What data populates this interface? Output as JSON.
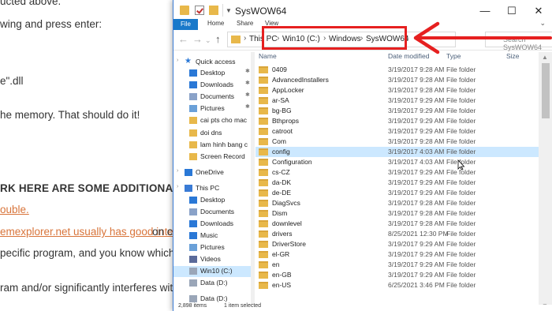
{
  "article": {
    "lines": [
      "ucted above.",
      "wing and press enter:",
      "e\".dll",
      "he memory. That should do it!",
      "RK HERE ARE SOME ADDITIONAL RESOURC",
      "ouble.",
      "emexplorer.net usually has good intel",
      "on c",
      "pecific program, and you know which one,",
      "ram and/or significantly interferes with usa"
    ]
  },
  "window": {
    "title": "SysWOW64",
    "controls": {
      "minimize": "—",
      "maximize": "☐",
      "close": "✕"
    }
  },
  "ribbon": {
    "tabs": [
      "File",
      "Home",
      "Share",
      "View"
    ]
  },
  "address": {
    "crumbs": [
      "This PC",
      "Win10 (C:)",
      "Windows",
      "SysWOW64"
    ]
  },
  "search": {
    "placeholder": "Search SysWOW64"
  },
  "nav": {
    "items": [
      {
        "label": "Quick access",
        "icon": "star-icon",
        "pinned": false
      },
      {
        "label": "Desktop",
        "icon": "desktop-icon",
        "pinned": true
      },
      {
        "label": "Downloads",
        "icon": "download-icon",
        "pinned": true
      },
      {
        "label": "Documents",
        "icon": "document-icon",
        "pinned": true
      },
      {
        "label": "Pictures",
        "icon": "picture-icon",
        "pinned": true
      },
      {
        "label": "cai pts cho mac",
        "icon": "folder-icon",
        "pinned": false
      },
      {
        "label": "doi dns",
        "icon": "folder-icon",
        "pinned": false
      },
      {
        "label": "lam hinh bang c",
        "icon": "folder-icon",
        "pinned": false
      },
      {
        "label": "Screen Record",
        "icon": "folder-icon",
        "pinned": false
      },
      {
        "label": "OneDrive",
        "icon": "cloud-icon",
        "pinned": false
      },
      {
        "label": "This PC",
        "icon": "computer-icon",
        "pinned": false
      },
      {
        "label": "Desktop",
        "icon": "desktop-icon",
        "pinned": false
      },
      {
        "label": "Documents",
        "icon": "document-icon",
        "pinned": false
      },
      {
        "label": "Downloads",
        "icon": "download-icon",
        "pinned": false
      },
      {
        "label": "Music",
        "icon": "music-icon",
        "pinned": false
      },
      {
        "label": "Pictures",
        "icon": "picture-icon",
        "pinned": false
      },
      {
        "label": "Videos",
        "icon": "video-icon",
        "pinned": false
      },
      {
        "label": "Win10 (C:)",
        "icon": "drive-icon",
        "pinned": false,
        "selected": true
      },
      {
        "label": "Data (D:)",
        "icon": "drive-icon",
        "pinned": false
      },
      {
        "label": "Data (D:)",
        "icon": "drive-icon",
        "pinned": false
      }
    ]
  },
  "columns": {
    "name": "Name",
    "date": "Date modified",
    "type": "Type",
    "size": "Size"
  },
  "files": [
    {
      "name": "0409",
      "date": "3/19/2017 9:28 AM",
      "type": "File folder"
    },
    {
      "name": "AdvancedInstallers",
      "date": "3/19/2017 9:28 AM",
      "type": "File folder"
    },
    {
      "name": "AppLocker",
      "date": "3/19/2017 9:28 AM",
      "type": "File folder"
    },
    {
      "name": "ar-SA",
      "date": "3/19/2017 9:29 AM",
      "type": "File folder"
    },
    {
      "name": "bg-BG",
      "date": "3/19/2017 9:29 AM",
      "type": "File folder"
    },
    {
      "name": "Bthprops",
      "date": "3/19/2017 9:29 AM",
      "type": "File folder"
    },
    {
      "name": "catroot",
      "date": "3/19/2017 9:29 AM",
      "type": "File folder"
    },
    {
      "name": "Com",
      "date": "3/19/2017 9:28 AM",
      "type": "File folder"
    },
    {
      "name": "config",
      "date": "3/19/2017 4:03 AM",
      "type": "File folder",
      "hover": true
    },
    {
      "name": "Configuration",
      "date": "3/19/2017 4:03 AM",
      "type": "File folder"
    },
    {
      "name": "cs-CZ",
      "date": "3/19/2017 9:29 AM",
      "type": "File folder"
    },
    {
      "name": "da-DK",
      "date": "3/19/2017 9:29 AM",
      "type": "File folder"
    },
    {
      "name": "de-DE",
      "date": "3/19/2017 9:29 AM",
      "type": "File folder"
    },
    {
      "name": "DiagSvcs",
      "date": "3/19/2017 9:28 AM",
      "type": "File folder"
    },
    {
      "name": "Dism",
      "date": "3/19/2017 9:28 AM",
      "type": "File folder"
    },
    {
      "name": "downlevel",
      "date": "3/19/2017 9:28 AM",
      "type": "File folder"
    },
    {
      "name": "drivers",
      "date": "8/25/2021 12:30 PM",
      "type": "File folder"
    },
    {
      "name": "DriverStore",
      "date": "3/19/2017 9:29 AM",
      "type": "File folder"
    },
    {
      "name": "el-GR",
      "date": "3/19/2017 9:29 AM",
      "type": "File folder"
    },
    {
      "name": "en",
      "date": "3/19/2017 9:29 AM",
      "type": "File folder"
    },
    {
      "name": "en-GB",
      "date": "3/19/2017 9:29 AM",
      "type": "File folder"
    },
    {
      "name": "en-US",
      "date": "6/25/2021 3:46 PM",
      "type": "File folder"
    }
  ],
  "status": {
    "count": "2,898 items",
    "selected": "1 item selected"
  },
  "colors": {
    "accent": "#1979ca",
    "annotation": "#e62020",
    "folder": "#e8b84a"
  }
}
